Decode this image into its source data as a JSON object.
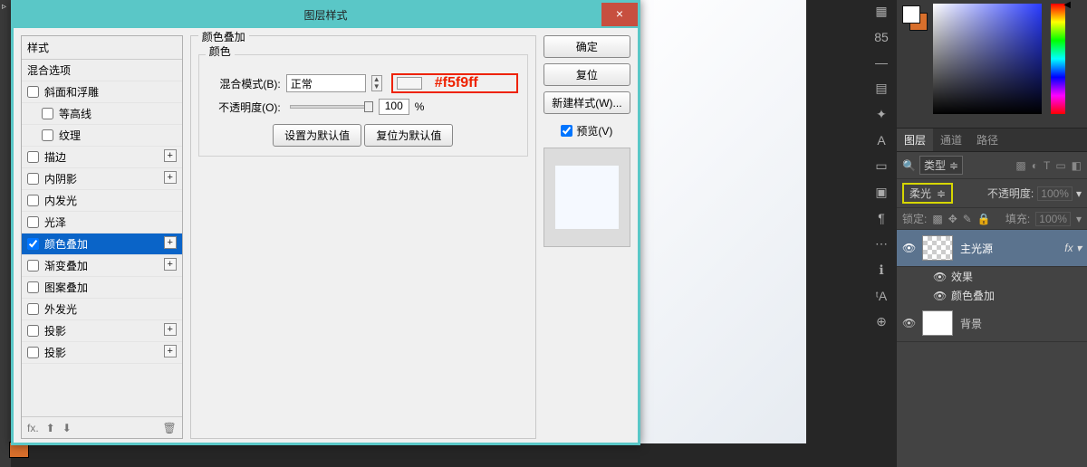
{
  "dialog": {
    "title": "图层样式",
    "close": "×",
    "styles_header": "样式",
    "styles": [
      {
        "label": "混合选项",
        "sub": false,
        "chk": false,
        "plus": false,
        "nochk": true
      },
      {
        "label": "斜面和浮雕",
        "sub": false,
        "chk": false,
        "plus": false
      },
      {
        "label": "等高线",
        "sub": true,
        "chk": false,
        "plus": false
      },
      {
        "label": "纹理",
        "sub": true,
        "chk": false,
        "plus": false
      },
      {
        "label": "描边",
        "sub": false,
        "chk": false,
        "plus": true
      },
      {
        "label": "内阴影",
        "sub": false,
        "chk": false,
        "plus": true
      },
      {
        "label": "内发光",
        "sub": false,
        "chk": false,
        "plus": false
      },
      {
        "label": "光泽",
        "sub": false,
        "chk": false,
        "plus": false
      },
      {
        "label": "颜色叠加",
        "sub": false,
        "chk": true,
        "plus": true,
        "sel": true
      },
      {
        "label": "渐变叠加",
        "sub": false,
        "chk": false,
        "plus": true
      },
      {
        "label": "图案叠加",
        "sub": false,
        "chk": false,
        "plus": false
      },
      {
        "label": "外发光",
        "sub": false,
        "chk": false,
        "plus": false
      },
      {
        "label": "投影",
        "sub": false,
        "chk": false,
        "plus": true
      },
      {
        "label": "投影",
        "sub": false,
        "chk": false,
        "plus": true
      }
    ],
    "fx_foot": "fx.",
    "trash": "🗑",
    "section_title": "颜色叠加",
    "inner_title": "颜色",
    "blend_label": "混合模式(B):",
    "blend_value": "正常",
    "hex_annotation": "#f5f9ff",
    "opacity_label": "不透明度(O):",
    "opacity_value": "100",
    "percent": "%",
    "set_default": "设置为默认值",
    "reset_default": "复位为默认值",
    "ok": "确定",
    "cancel": "复位",
    "new_style": "新建样式(W)...",
    "preview": "预览(V)"
  },
  "right_strip_icons": [
    "▦",
    "85",
    "—",
    "▤",
    "✦",
    "A",
    "▭",
    "▣",
    "¶",
    "⋯",
    "ℹ",
    "ᵗA",
    "⊕"
  ],
  "panels": {
    "tabs": [
      "图层",
      "通道",
      "路径"
    ],
    "kind_label": "类型",
    "blend_mode": "柔光",
    "opacity_label": "不透明度:",
    "opacity_value": "100%",
    "lock_label": "锁定:",
    "fill_label": "填充:",
    "fill_value": "100%",
    "layers": [
      {
        "name": "主光源",
        "sel": true,
        "checker": true,
        "fx": true
      },
      {
        "name": "背景",
        "sel": false,
        "checker": false,
        "fx": false
      }
    ],
    "fx_label": "fx",
    "fx_effects_title": "效果",
    "fx_effect_item": "颜色叠加"
  }
}
